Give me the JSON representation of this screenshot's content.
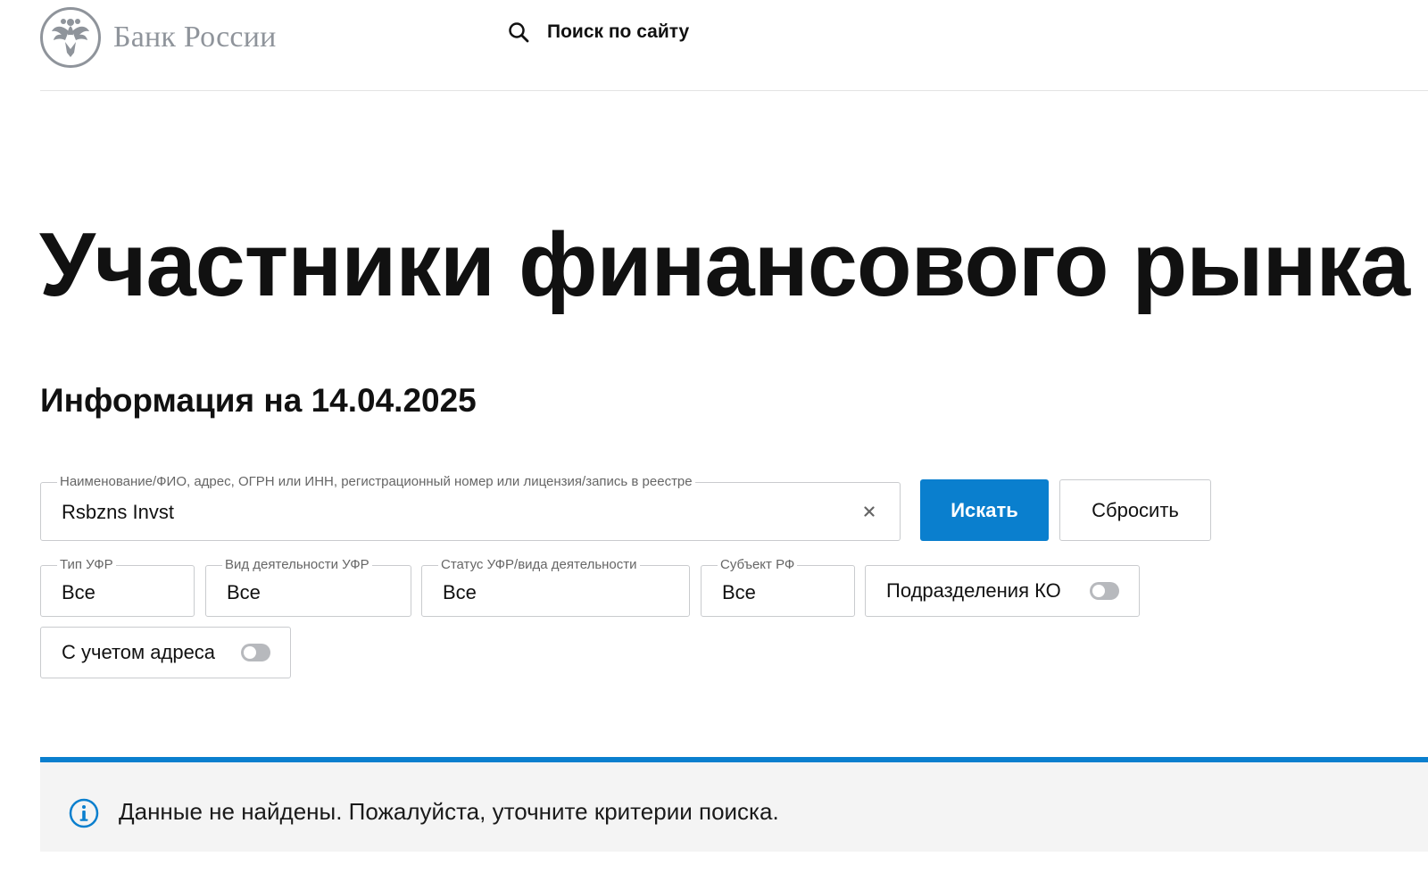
{
  "header": {
    "logo_text": "Банк России",
    "site_search_label": "Поиск по сайту"
  },
  "main": {
    "title": "Участники финансового рынка",
    "subtitle": "Информация на 14.04.2025"
  },
  "search": {
    "legend": "Наименование/ФИО, адрес, ОГРН или ИНН, регистрационный номер или лицензия/запись в реестре",
    "value": "Rsbzns Invst",
    "submit_label": "Искать",
    "reset_label": "Сбросить"
  },
  "filters": {
    "type": {
      "legend": "Тип УФР",
      "value": "Все"
    },
    "activity": {
      "legend": "Вид деятельности УФР",
      "value": "Все"
    },
    "status": {
      "legend": "Статус УФР/вида деятельности",
      "value": "Все"
    },
    "region": {
      "legend": "Субъект РФ",
      "value": "Все"
    },
    "branches_toggle": {
      "label": "Подразделения КО",
      "on": false
    },
    "address_toggle": {
      "label": "С учетом адреса",
      "on": false
    }
  },
  "notice": {
    "text": "Данные не найдены. Пожалуйста, уточните критерии поиска."
  },
  "colors": {
    "accent": "#0a7fce",
    "logo_gray": "#8f949b",
    "notice_bg": "#f4f4f4"
  },
  "icons": {
    "logo": "double-headed-eagle-icon",
    "site_search": "search-icon",
    "clear": "close-icon",
    "notice": "info-icon"
  }
}
